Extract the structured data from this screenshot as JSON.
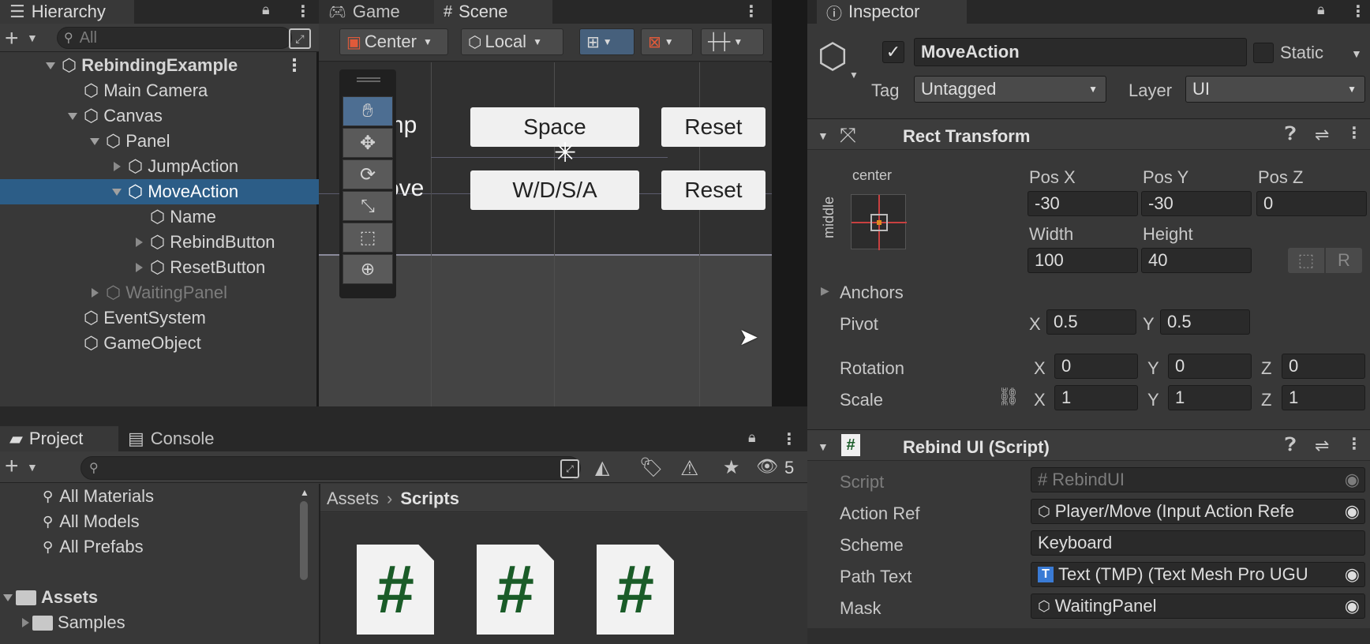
{
  "hierarchy": {
    "tab": "Hierarchy",
    "search_placeholder": "All",
    "items": [
      {
        "label": "RebindingExample",
        "indent": 0,
        "expand": "open",
        "bold": true,
        "icon": "unity-scene-icon"
      },
      {
        "label": "Main Camera",
        "indent": 1,
        "expand": "none",
        "icon": "gameobject-cube-icon"
      },
      {
        "label": "Canvas",
        "indent": 1,
        "expand": "open",
        "icon": "gameobject-cube-icon"
      },
      {
        "label": "Panel",
        "indent": 2,
        "expand": "open",
        "icon": "gameobject-cube-icon"
      },
      {
        "label": "JumpAction",
        "indent": 3,
        "expand": "closed",
        "icon": "gameobject-cube-icon"
      },
      {
        "label": "MoveAction",
        "indent": 3,
        "expand": "open",
        "selected": true,
        "icon": "gameobject-cube-icon"
      },
      {
        "label": "Name",
        "indent": 4,
        "expand": "none",
        "icon": "gameobject-cube-icon"
      },
      {
        "label": "RebindButton",
        "indent": 4,
        "expand": "closed",
        "icon": "gameobject-cube-icon"
      },
      {
        "label": "ResetButton",
        "indent": 4,
        "expand": "closed",
        "icon": "gameobject-cube-icon"
      },
      {
        "label": "WaitingPanel",
        "indent": 2,
        "expand": "closed",
        "dim": true,
        "icon": "gameobject-cube-icon"
      },
      {
        "label": "EventSystem",
        "indent": 1,
        "expand": "none",
        "icon": "gameobject-cube-icon"
      },
      {
        "label": "GameObject",
        "indent": 1,
        "expand": "none",
        "icon": "gameobject-cube-icon"
      }
    ]
  },
  "viewport": {
    "tabs": [
      "Game",
      "Scene"
    ],
    "pivot_label": "Center",
    "space_label": "Local",
    "game": {
      "jump_label": "ump",
      "move_label": "Move",
      "jump_binding": "Space",
      "move_binding": "W/D/S/A",
      "reset_label": "Reset"
    }
  },
  "project": {
    "tabs": [
      "Project",
      "Console"
    ],
    "hidden_count": "5",
    "favorites": [
      "All Materials",
      "All Models",
      "All Prefabs"
    ],
    "assets_label": "Assets",
    "samples_label": "Samples",
    "breadcrumb": {
      "root": "Assets",
      "current": "Scripts"
    },
    "file_glyph": "#"
  },
  "inspector": {
    "tab": "Inspector",
    "object_name": "MoveAction",
    "static_label": "Static",
    "tag_label": "Tag",
    "tag_value": "Untagged",
    "layer_label": "Layer",
    "layer_value": "UI",
    "rect": {
      "title": "Rect Transform",
      "anchor_h": "center",
      "anchor_v": "middle",
      "posx_label": "Pos X",
      "posy_label": "Pos Y",
      "posz_label": "Pos Z",
      "posx": "-30",
      "posy": "-30",
      "posz": "0",
      "width_label": "Width",
      "height_label": "Height",
      "width": "100",
      "height": "40",
      "r_button": "R",
      "anchors_label": "Anchors",
      "pivot_label": "Pivot",
      "pivot_x": "0.5",
      "pivot_y": "0.5",
      "rotation_label": "Rotation",
      "rot_x": "0",
      "rot_y": "0",
      "rot_z": "0",
      "scale_label": "Scale",
      "scale_x": "1",
      "scale_y": "1",
      "scale_z": "1",
      "x": "X",
      "y": "Y",
      "z": "Z"
    },
    "script": {
      "title": "Rebind UI (Script)",
      "script_label": "Script",
      "script_value": "RebindUI",
      "action_label": "Action Ref",
      "action_value": "Player/Move (Input Action Refe",
      "scheme_label": "Scheme",
      "scheme_value": "Keyboard",
      "path_label": "Path Text",
      "path_value": "Text (TMP) (Text Mesh Pro UGU",
      "mask_label": "Mask",
      "mask_value": "WaitingPanel"
    }
  },
  "colors": {
    "selection": "#2c5d87",
    "panel": "#383838",
    "field": "#2a2a2a"
  }
}
